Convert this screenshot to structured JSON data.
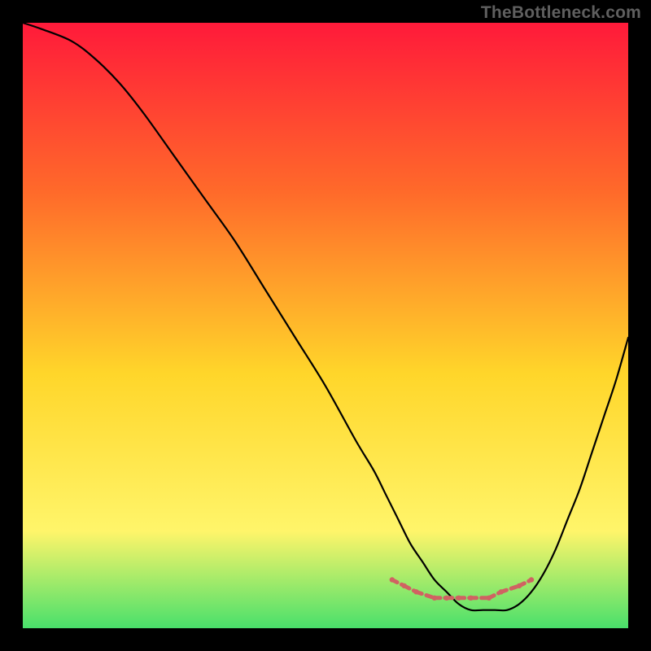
{
  "watermark": "TheBottleneck.com",
  "colors": {
    "background": "#000000",
    "watermark_text": "#5f5f5f",
    "gradient_top": "#ff1a3a",
    "gradient_mid1": "#ff6a2a",
    "gradient_mid2": "#ffd62a",
    "gradient_mid3": "#fff56a",
    "gradient_bottom": "#49e06b",
    "curve": "#000000",
    "markers": "#d06262"
  },
  "chart_data": {
    "type": "line",
    "title": "",
    "xlabel": "",
    "ylabel": "",
    "xlim": [
      0,
      100
    ],
    "ylim": [
      0,
      100
    ],
    "x": [
      0,
      3,
      8,
      12,
      16,
      20,
      25,
      30,
      35,
      40,
      45,
      50,
      55,
      58,
      60,
      62,
      64,
      66,
      68,
      70,
      72,
      74,
      76,
      78,
      80,
      82,
      84,
      86,
      88,
      90,
      92,
      94,
      96,
      98,
      100
    ],
    "values": [
      100,
      99,
      97,
      94,
      90,
      85,
      78,
      71,
      64,
      56,
      48,
      40,
      31,
      26,
      22,
      18,
      14,
      11,
      8,
      6,
      4,
      3,
      3,
      3,
      3,
      4,
      6,
      9,
      13,
      18,
      23,
      29,
      35,
      41,
      48
    ],
    "markers": {
      "x": [
        61,
        63,
        65,
        68,
        70,
        72,
        74,
        77,
        79,
        82,
        84
      ],
      "values": [
        8,
        7,
        6,
        5,
        5,
        5,
        5,
        5,
        6,
        7,
        8
      ]
    },
    "legend": [],
    "grid": false
  }
}
